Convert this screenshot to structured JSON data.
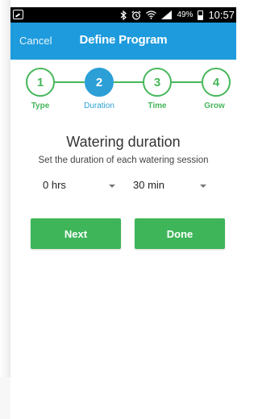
{
  "status_bar": {
    "battery_percent": "49%",
    "time": "10:57",
    "icons": [
      "notification-icon",
      "bluetooth-icon",
      "alarm-icon",
      "wifi-icon",
      "signal-icon",
      "battery-icon"
    ]
  },
  "app_bar": {
    "cancel_label": "Cancel",
    "title": "Define Program",
    "background_color": "#1e9bdc"
  },
  "stepper": {
    "active_step": 2,
    "steps": [
      {
        "number": "1",
        "label": "Type"
      },
      {
        "number": "2",
        "label": "Duration"
      },
      {
        "number": "3",
        "label": "Time"
      },
      {
        "number": "4",
        "label": "Grow"
      }
    ],
    "completed_color": "#46b75a",
    "active_color": "#2b9fd6"
  },
  "content": {
    "heading": "Watering duration",
    "subheading": "Set the duration of each watering session",
    "hours_select": {
      "value": "0 hrs"
    },
    "minutes_select": {
      "value": "30 min"
    }
  },
  "actions": {
    "next_label": "Next",
    "done_label": "Done",
    "button_color": "#3fb55a"
  }
}
